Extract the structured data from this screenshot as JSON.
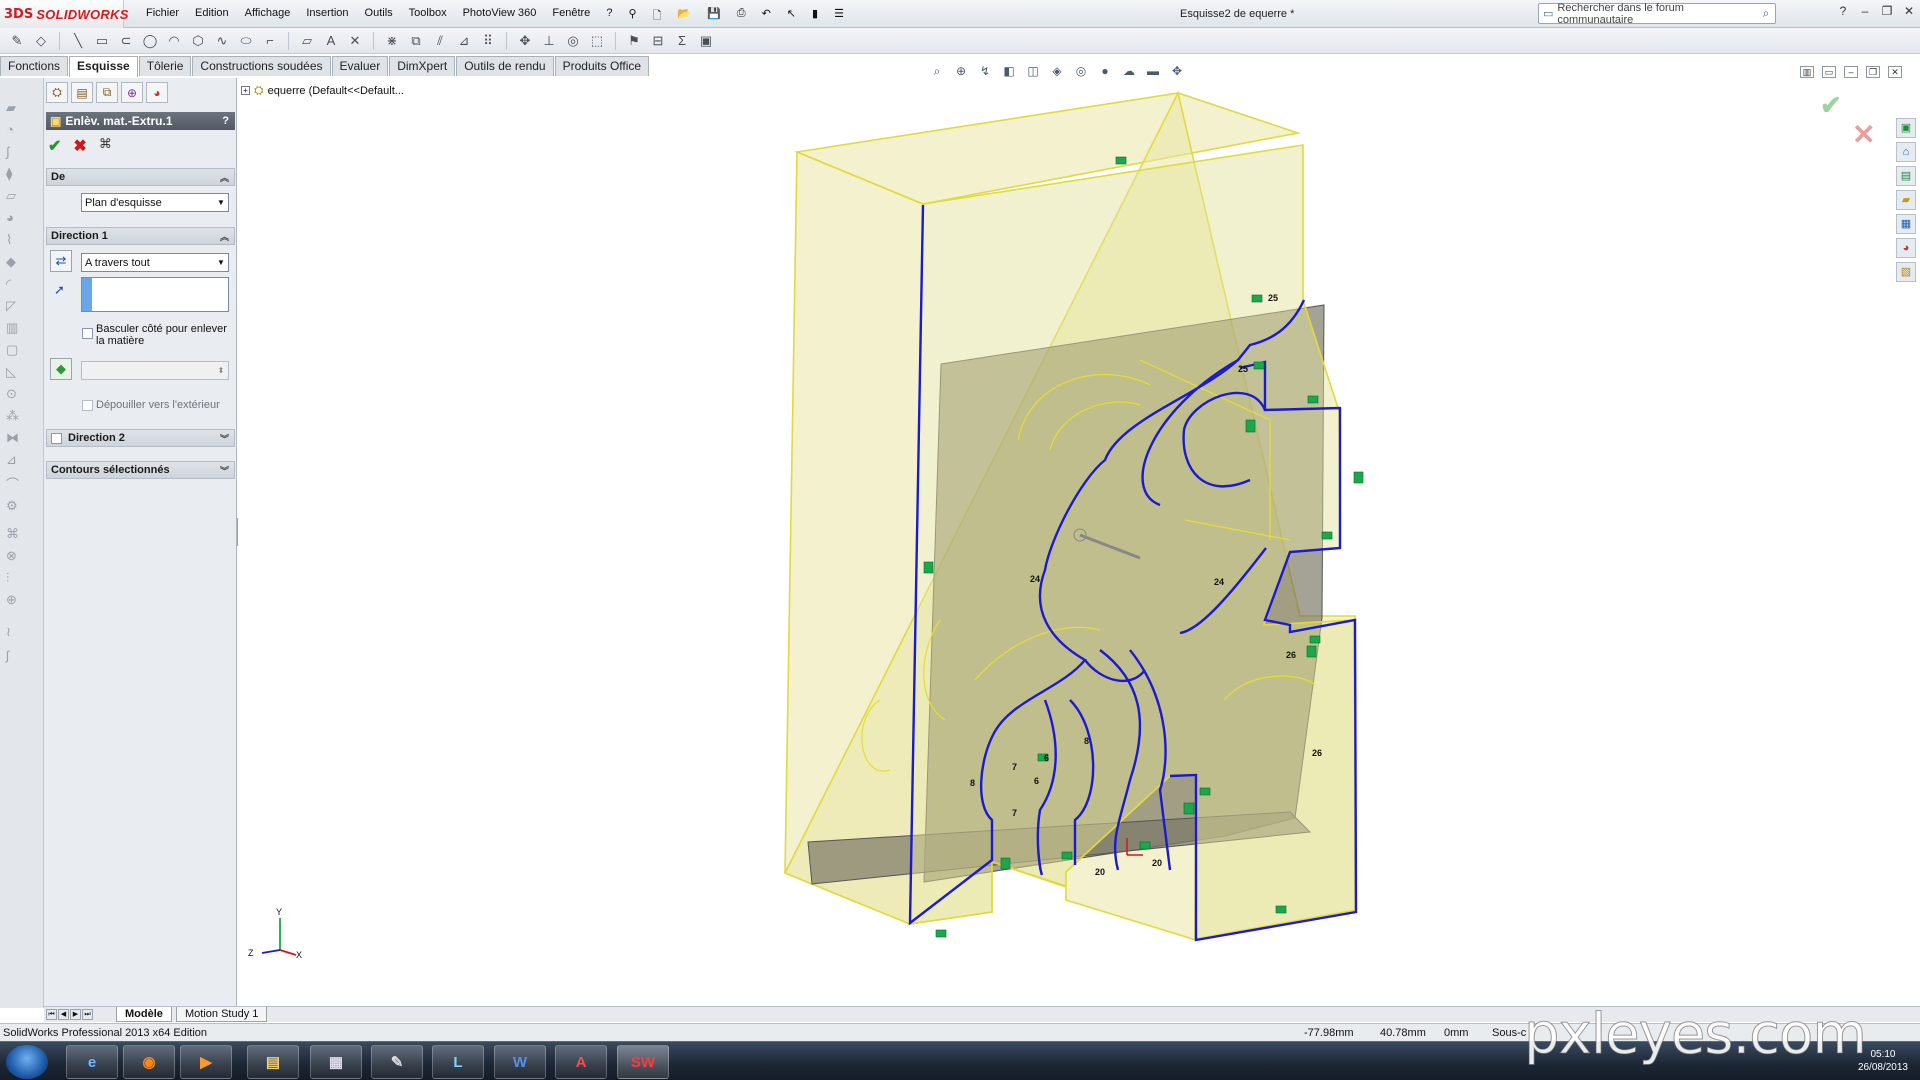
{
  "app": {
    "brand": "SOLIDWORKS",
    "brand_prefix": "3DS",
    "document_title": "Esquisse2 de equerre *",
    "menus": [
      "Fichier",
      "Edition",
      "Affichage",
      "Insertion",
      "Outils",
      "Toolbox",
      "PhotoView 360",
      "Fenêtre",
      "?"
    ],
    "search_placeholder": "Rechercher dans le forum communautaire"
  },
  "command_tabs": [
    {
      "label": "Fonctions",
      "active": false
    },
    {
      "label": "Esquisse",
      "active": true
    },
    {
      "label": "Tôlerie",
      "active": false
    },
    {
      "label": "Constructions soudées",
      "active": false
    },
    {
      "label": "Evaluer",
      "active": false
    },
    {
      "label": "DimXpert",
      "active": false
    },
    {
      "label": "Outils de rendu",
      "active": false
    },
    {
      "label": "Produits Office",
      "active": false
    }
  ],
  "property_manager": {
    "title": "Enlèv. mat.-Extru.1",
    "help": "?",
    "de": {
      "header": "De",
      "start_condition": "Plan d'esquisse"
    },
    "direction1": {
      "header": "Direction 1",
      "end_condition": "A travers tout",
      "flip_side_label": "Basculer côté pour enlever la matière",
      "draft_outward_label": "Dépouiller vers l'extérieur"
    },
    "direction2": {
      "header": "Direction 2"
    },
    "selected_contours": {
      "header": "Contours sélectionnés"
    }
  },
  "tree": {
    "root_label": "equerre  (Default<<Default..."
  },
  "bottom_tabs": [
    "Modèle",
    "Motion Study 1"
  ],
  "status": {
    "edition": "SolidWorks Professional 2013 x64 Edition",
    "x": "-77.98mm",
    "y": "40.78mm",
    "z": "0mm",
    "state": "Sous-c"
  },
  "taskbar": {
    "date": "26/08/2013",
    "time": "05:10"
  },
  "watermark": "pxleyes.com",
  "sketch_labels": [
    "25",
    "25",
    "24",
    "24",
    "26",
    "26",
    "8",
    "6",
    "6",
    "7",
    "8",
    "7",
    "20",
    "20"
  ],
  "triad_labels": {
    "y": "Y",
    "z": "Z",
    "x": "X"
  },
  "colors": {
    "body_fill": "#e9e6a6",
    "body_edge": "#e1da3c",
    "sketch": "#1a1ad0",
    "relation": "#1aa84a",
    "panel_header": "#5f6672"
  }
}
